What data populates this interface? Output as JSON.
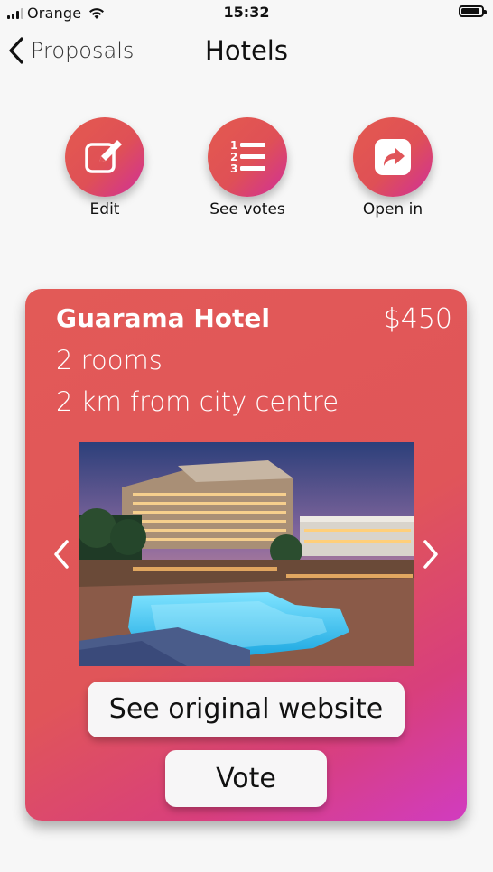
{
  "status_bar": {
    "carrier": "Orange",
    "time": "15:32",
    "battery_level": 0.9
  },
  "nav": {
    "back_label": "Proposals",
    "title": "Hotels"
  },
  "actions": [
    {
      "label": "Edit",
      "icon": "edit-icon"
    },
    {
      "label": "See votes",
      "icon": "numbered-list-icon"
    },
    {
      "label": "Open in",
      "icon": "share-icon"
    }
  ],
  "card": {
    "hotel_name": "Guarama Hotel",
    "price": "$450",
    "rooms": "2 rooms",
    "distance": "2 km from city centre",
    "website_button": "See original website",
    "vote_button": "Vote"
  },
  "colors": {
    "accent": "#e05559",
    "accent_end": "#d13cc0",
    "background": "#f7f7f7"
  }
}
